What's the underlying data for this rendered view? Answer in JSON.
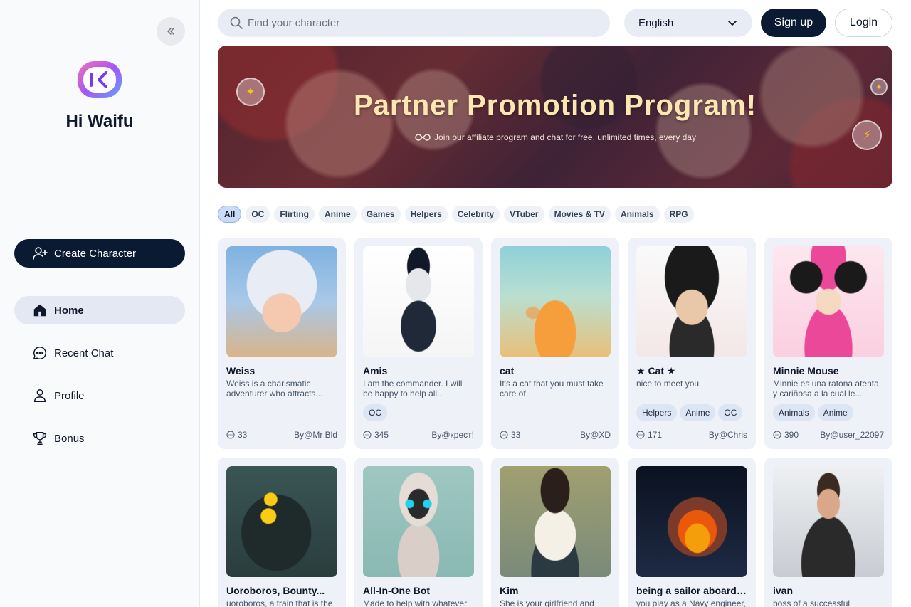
{
  "sidebar": {
    "brand": "Hi Waifu",
    "create_label": "Create Character",
    "nav": [
      {
        "label": "Home",
        "icon": "home-icon"
      },
      {
        "label": "Recent Chat",
        "icon": "chat-icon"
      },
      {
        "label": "Profile",
        "icon": "user-icon"
      },
      {
        "label": "Bonus",
        "icon": "trophy-icon"
      }
    ]
  },
  "header": {
    "search_placeholder": "Find your character",
    "language": "English",
    "signup_label": "Sign up",
    "login_label": "Login"
  },
  "banner": {
    "title": "Partner Promotion Program!",
    "subtitle": "Join our affiliate program and chat for free, unlimited times, every day"
  },
  "categories": [
    "All",
    "OC",
    "Flirting",
    "Anime",
    "Games",
    "Helpers",
    "Celebrity",
    "VTuber",
    "Movies & TV",
    "Animals",
    "RPG"
  ],
  "active_category": "All",
  "characters": [
    {
      "name": "Weiss",
      "desc": "Weiss is a charismatic adventurer who attracts...",
      "tags": [],
      "chats": "33",
      "author": "By@Mr Bld"
    },
    {
      "name": "Amis",
      "desc": "I am the commander. I will be happy to help all...",
      "tags": [
        "OC"
      ],
      "chats": "345",
      "author": "By@крест!"
    },
    {
      "name": "cat",
      "desc": "It's a cat that you must take care of",
      "tags": [],
      "chats": "33",
      "author": "By@XD"
    },
    {
      "name": "★ Cat ★",
      "desc": "nice to meet you",
      "tags": [
        "Helpers",
        "Anime",
        "OC"
      ],
      "chats": "171",
      "author": "By@Chris"
    },
    {
      "name": "Minnie Mouse",
      "desc": "Minnie es una ratona atenta y cariñosa a la cual le...",
      "tags": [
        "Animals",
        "Anime"
      ],
      "chats": "390",
      "author": "By@user_22097"
    },
    {
      "name": "Uoroboros, Bounty...",
      "desc": "uoroboros, a train that is the",
      "tags": [],
      "chats": "",
      "author": ""
    },
    {
      "name": "All-In-One Bot",
      "desc": "Made to help with whatever",
      "tags": [],
      "chats": "",
      "author": ""
    },
    {
      "name": "Kim",
      "desc": "She is your girlfriend and",
      "tags": [],
      "chats": "",
      "author": ""
    },
    {
      "name": "being a sailor aboard ...",
      "desc": "you play as a Navy engineer,",
      "tags": [],
      "chats": "",
      "author": ""
    },
    {
      "name": "ivan",
      "desc": "boss of a successful",
      "tags": [],
      "chats": "",
      "author": ""
    }
  ],
  "colors": {
    "primary": "#0b1a33",
    "accent_bg": "#e8ecf4",
    "card_bg": "#eef2f8"
  }
}
